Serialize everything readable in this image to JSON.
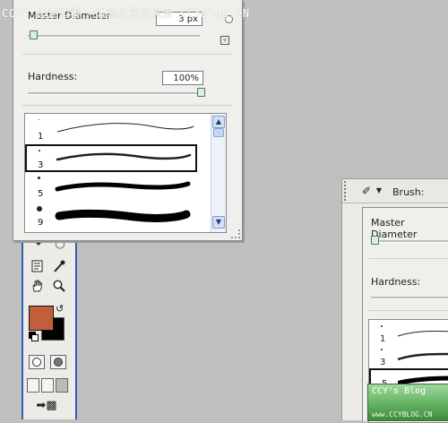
{
  "watermark": "CCY’      边走边看  —体验心灵的风景  CCYBlog.CN",
  "brush_panel": {
    "master_diameter_label": "Master Diameter",
    "master_diameter_value": "3 px",
    "diameter_slider_fraction": 0.01,
    "hardness_label": "Hardness:",
    "hardness_value": "100%",
    "hardness_slider_fraction": 1.0,
    "brushes": [
      {
        "size": "1"
      },
      {
        "size": "3",
        "selected": true
      },
      {
        "size": "5"
      },
      {
        "size": "9"
      }
    ]
  },
  "toolbox": {
    "foreground_color": "#c15f3c",
    "background_color": "#000000",
    "tools": [
      "brush-tool-icon",
      "eyedropper-icon",
      "hand-icon",
      "zoom-icon",
      "notes-icon"
    ]
  },
  "options_window": {
    "brush_label": "Brush:",
    "master_diameter_label": "Master Diameter",
    "hardness_label": "Hardness:",
    "brushes": [
      {
        "size": "1"
      },
      {
        "size": "3"
      },
      {
        "size": "5"
      }
    ]
  },
  "logo": {
    "line1": "CCY's Blog",
    "line2": "www.CCYBLOG.CN"
  }
}
